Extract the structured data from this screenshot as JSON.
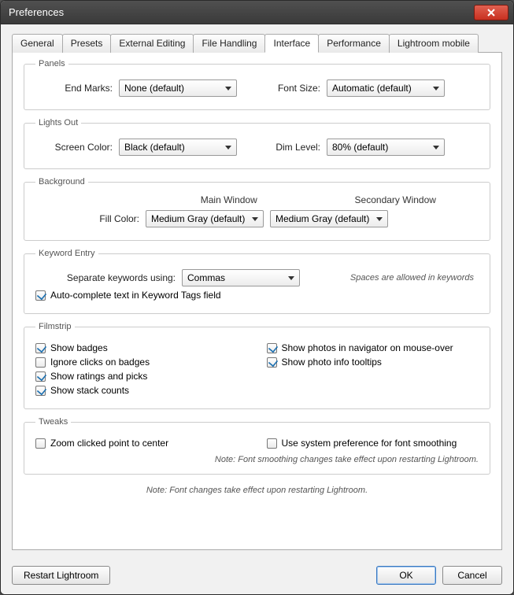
{
  "window": {
    "title": "Preferences"
  },
  "tabs": [
    "General",
    "Presets",
    "External Editing",
    "File Handling",
    "Interface",
    "Performance",
    "Lightroom mobile"
  ],
  "active_tab": 4,
  "panels": {
    "title": "Panels",
    "end_marks_label": "End Marks:",
    "end_marks_value": "None (default)",
    "font_size_label": "Font Size:",
    "font_size_value": "Automatic (default)"
  },
  "lights_out": {
    "title": "Lights Out",
    "screen_color_label": "Screen Color:",
    "screen_color_value": "Black (default)",
    "dim_level_label": "Dim Level:",
    "dim_level_value": "80% (default)"
  },
  "background": {
    "title": "Background",
    "main_header": "Main Window",
    "secondary_header": "Secondary Window",
    "fill_color_label": "Fill Color:",
    "main_value": "Medium Gray (default)",
    "secondary_value": "Medium Gray (default)"
  },
  "keyword_entry": {
    "title": "Keyword Entry",
    "separate_label": "Separate keywords using:",
    "separate_value": "Commas",
    "spaces_hint": "Spaces are allowed in keywords",
    "autocomplete_label": "Auto-complete text in Keyword Tags field",
    "autocomplete_checked": true
  },
  "filmstrip": {
    "title": "Filmstrip",
    "left": [
      {
        "label": "Show badges",
        "checked": true
      },
      {
        "label": "Ignore clicks on badges",
        "checked": false
      },
      {
        "label": "Show ratings and picks",
        "checked": true
      },
      {
        "label": "Show stack counts",
        "checked": true
      }
    ],
    "right": [
      {
        "label": "Show photos in navigator on mouse-over",
        "checked": true
      },
      {
        "label": "Show photo info tooltips",
        "checked": true
      }
    ]
  },
  "tweaks": {
    "title": "Tweaks",
    "zoom_label": "Zoom clicked point to center",
    "zoom_checked": false,
    "font_smoothing_label": "Use system preference for font smoothing",
    "font_smoothing_checked": false,
    "smoothing_note": "Note: Font smoothing changes take effect upon restarting Lightroom."
  },
  "global_note": "Note: Font changes take effect upon restarting Lightroom.",
  "buttons": {
    "restart": "Restart Lightroom",
    "ok": "OK",
    "cancel": "Cancel"
  }
}
